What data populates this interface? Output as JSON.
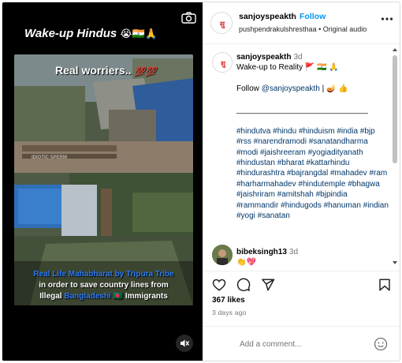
{
  "media": {
    "overlay_title": "Wake-up Hindus",
    "overlay_title_emojis": "😭🇮🇳🙏",
    "video_heading": "Real worriers..",
    "video_heading_emojis": "💯💯",
    "watermark": "IDIOTIC SPERM",
    "caption_line1": "Real Life Mahabharat by Tripura Tribe",
    "caption_line2": "in order to save country lines from",
    "caption_line3_a": "Illegal",
    "caption_line3_b": "Bangladeshi",
    "caption_line3_c": "🇧🇩 Immigrants",
    "icons": {
      "top_right": "camera-icon",
      "bottom_right": "mute-icon"
    }
  },
  "header": {
    "avatar_text": "सु",
    "username": "sanjoyspeakth",
    "separator": "•",
    "follow_label": "Follow",
    "audio": "pushpendrakulshresthaa • Original audio"
  },
  "post": {
    "username": "sanjoyspeakth",
    "time": "3d",
    "line1": "Wake-up to Reality 🚩 🇮🇳 🙏",
    "follow_prefix": "Follow",
    "follow_handle": "@sanjoyspeakth",
    "follow_suffix": "| 🪔 👍",
    "divider": "______________________________",
    "hashtags": "#hindutva #hindu #hinduism #india #bjp #rss #narendramodi #sanatandharma #modi #jaishreeram #yogiadityanath #hindustan #bharat #kattarhindu #hindurashtra #bajrangdal #mahadev #ram #harharmahadev #hindutemple #bhagwa #jaishriram #amitshah #bjpindia #rammandir #hindugods #hanuman #indian #yogi #sanatan"
  },
  "comment2": {
    "username": "bibeksingh13",
    "time": "3d",
    "text": "👏💖"
  },
  "actions": {
    "likes": "367 likes",
    "ago": "3 days ago",
    "icons": [
      "heart-icon",
      "comment-icon",
      "share-icon",
      "bookmark-icon"
    ]
  },
  "add_comment": {
    "placeholder": "Add a comment...",
    "emoji_icon": "smiley-icon"
  },
  "colors": {
    "accent": "#0095f6",
    "link": "#00376b",
    "muted": "#737373",
    "caption_blue": "#2d7bf4"
  }
}
